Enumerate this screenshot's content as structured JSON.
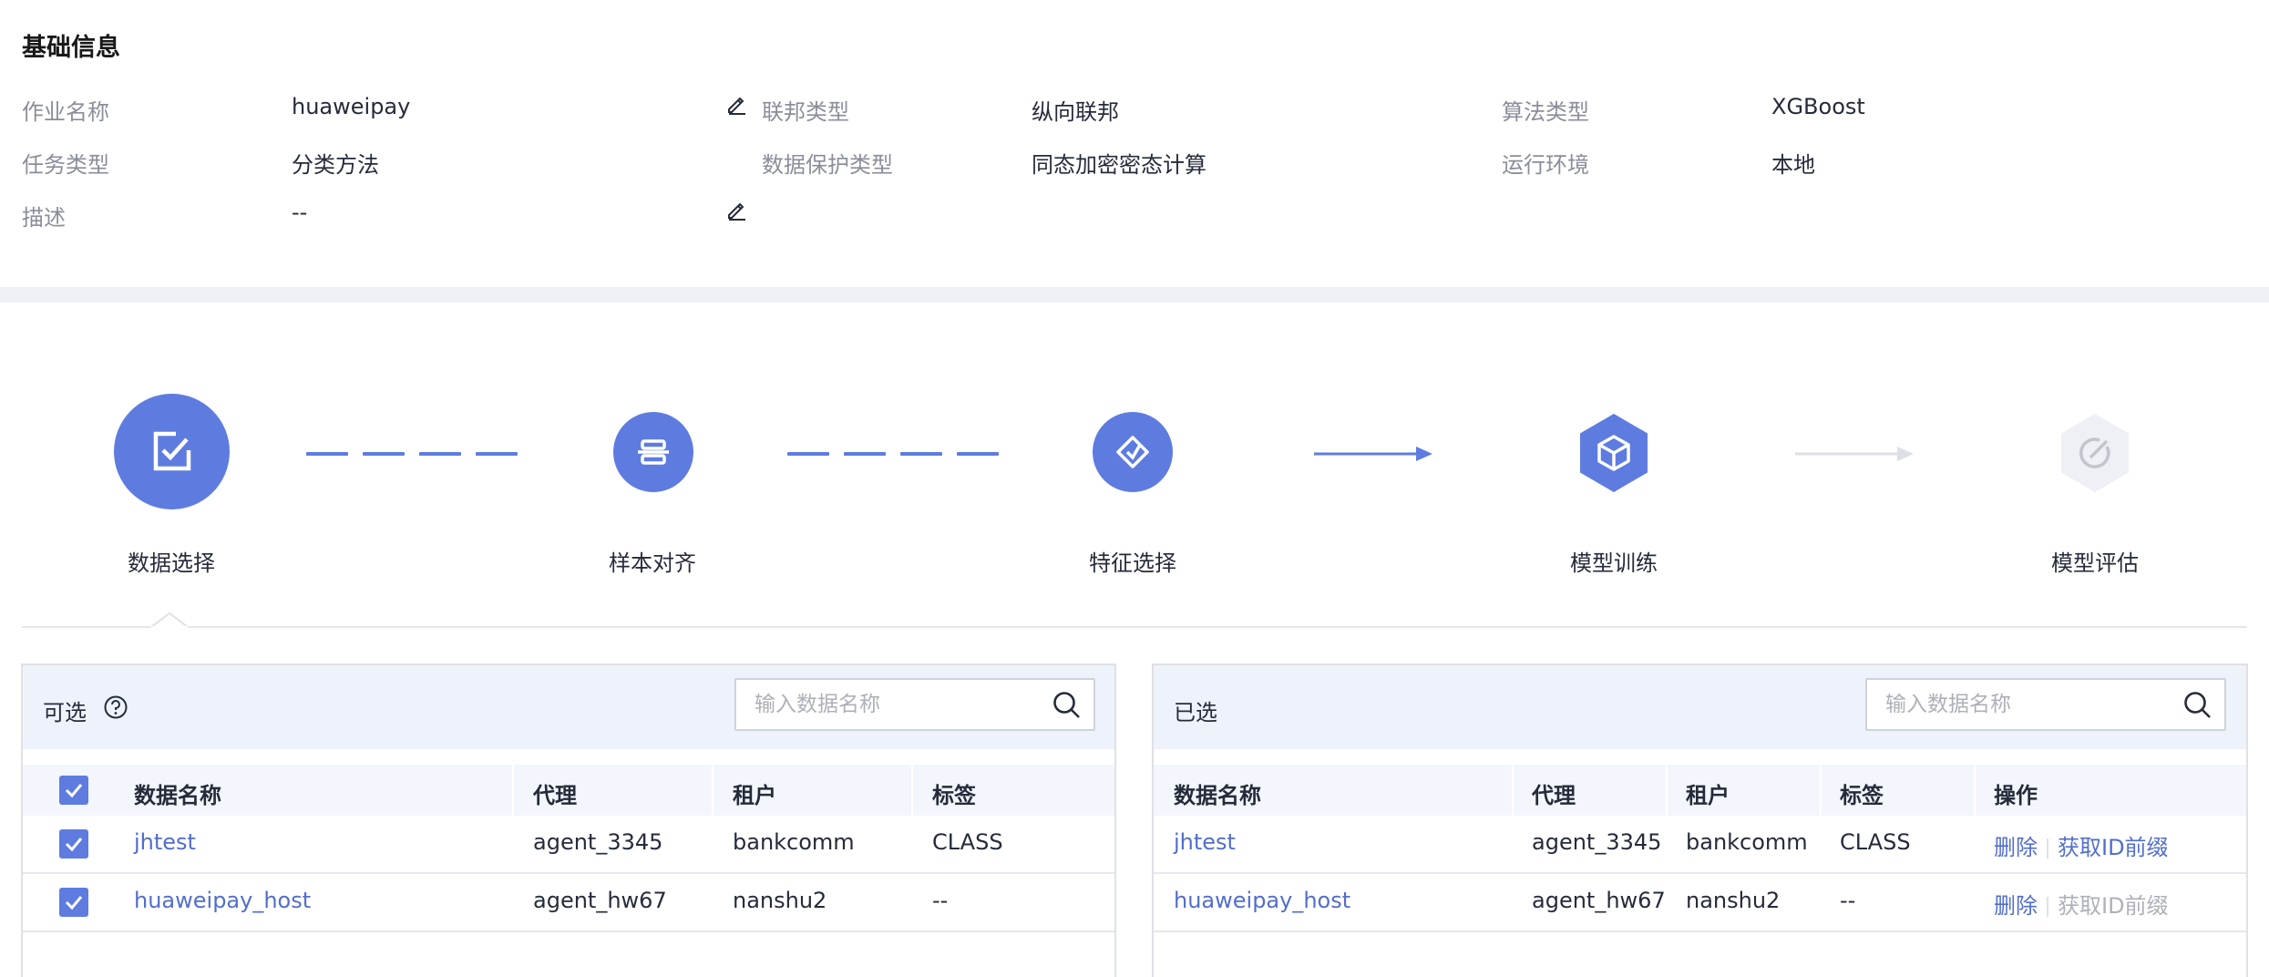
{
  "basic_info": {
    "title": "基础信息",
    "job_name_label": "作业名称",
    "job_name_value": "huaweipay",
    "task_type_label": "任务类型",
    "task_type_value": "分类方法",
    "description_label": "描述",
    "description_value": "--",
    "federation_type_label": "联邦类型",
    "federation_type_value": "纵向联邦",
    "data_protection_label": "数据保护类型",
    "data_protection_value": "同态加密密态计算",
    "algorithm_type_label": "算法类型",
    "algorithm_type_value": "XGBoost",
    "runtime_env_label": "运行环境",
    "runtime_env_value": "本地"
  },
  "stepper": {
    "steps": [
      {
        "label": "数据选择",
        "icon": "checkbox-edit-icon",
        "state": "active"
      },
      {
        "label": "样本对齐",
        "icon": "align-icon",
        "state": "done"
      },
      {
        "label": "特征选择",
        "icon": "feature-icon",
        "state": "done"
      },
      {
        "label": "模型训练",
        "icon": "cube-icon",
        "state": "done"
      },
      {
        "label": "模型评估",
        "icon": "evaluate-icon",
        "state": "disabled"
      }
    ]
  },
  "available_panel": {
    "title": "可选",
    "search_placeholder": "输入数据名称",
    "columns": [
      "数据名称",
      "代理",
      "租户",
      "标签"
    ],
    "rows": [
      {
        "name": "jhtest",
        "agent": "agent_3345",
        "tenant": "bankcomm",
        "tag": "CLASS",
        "checked": true
      },
      {
        "name": "huaweipay_host",
        "agent": "agent_hw67",
        "tenant": "nanshu2",
        "tag": "--",
        "checked": true
      }
    ]
  },
  "selected_panel": {
    "title": "已选",
    "search_placeholder": "输入数据名称",
    "columns": [
      "数据名称",
      "代理",
      "租户",
      "标签",
      "操作"
    ],
    "rows": [
      {
        "name": "jhtest",
        "agent": "agent_3345",
        "tenant": "bankcomm",
        "tag": "CLASS",
        "delete": "删除",
        "get_prefix": "获取ID前缀",
        "get_prefix_enabled": true
      },
      {
        "name": "huaweipay_host",
        "agent": "agent_hw67",
        "tenant": "nanshu2",
        "tag": "--",
        "delete": "删除",
        "get_prefix": "获取ID前缀",
        "get_prefix_enabled": false
      }
    ]
  },
  "colors": {
    "primary": "#5e7ce0",
    "link": "#526ecc",
    "disabled": "#dcdfe6",
    "text": "#252b3a",
    "label": "#8a8e99"
  }
}
